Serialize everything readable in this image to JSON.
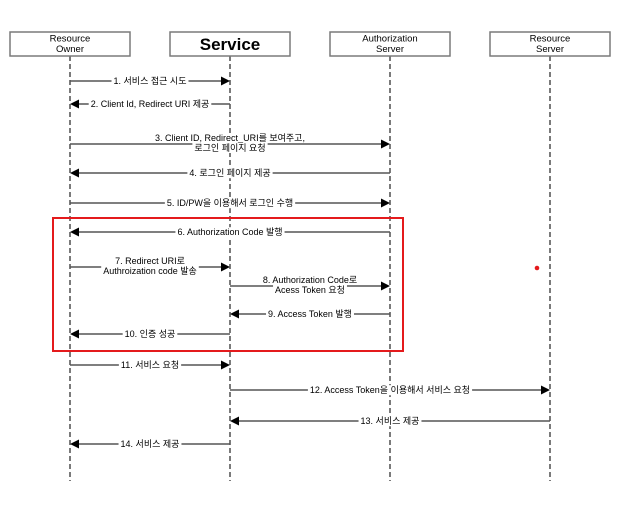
{
  "diagram": {
    "type": "sequence",
    "actors": [
      {
        "id": "resource-owner",
        "label_lines": [
          "Resource",
          "Owner"
        ],
        "emphasis": false
      },
      {
        "id": "service",
        "label_lines": [
          "Service"
        ],
        "emphasis": true
      },
      {
        "id": "authorization-server",
        "label_lines": [
          "Authorization",
          "Server"
        ],
        "emphasis": false
      },
      {
        "id": "resource-server",
        "label_lines": [
          "Resource",
          "Server"
        ],
        "emphasis": false
      }
    ],
    "messages": [
      {
        "step": 1,
        "from": 0,
        "to": 1,
        "label_lines": [
          "1. 서비스 접근 시도"
        ]
      },
      {
        "step": 2,
        "from": 1,
        "to": 0,
        "label_lines": [
          "2. Client Id, Redirect URI 제공"
        ]
      },
      {
        "step": 3,
        "from": 0,
        "to": 2,
        "label_lines": [
          "3. Client ID, Redirect_URI를 보여주고,",
          "로그인 페이지 요청"
        ]
      },
      {
        "step": 4,
        "from": 2,
        "to": 0,
        "label_lines": [
          "4. 로그인 페이지 제공"
        ]
      },
      {
        "step": 5,
        "from": 0,
        "to": 2,
        "label_lines": [
          "5. ID/PW을 이용해서 로그인 수행"
        ]
      },
      {
        "step": 6,
        "from": 2,
        "to": 0,
        "label_lines": [
          "6. Authorization Code 발행"
        ]
      },
      {
        "step": 7,
        "from": 0,
        "to": 1,
        "label_lines": [
          "7. Redirect URI로",
          "Authroization code 발송"
        ]
      },
      {
        "step": 8,
        "from": 1,
        "to": 2,
        "label_lines": [
          "8. Authorization Code로",
          "Acess Token 요청"
        ]
      },
      {
        "step": 9,
        "from": 2,
        "to": 1,
        "label_lines": [
          "9. Access Token 발행"
        ]
      },
      {
        "step": 10,
        "from": 1,
        "to": 0,
        "label_lines": [
          "10. 인증 성공"
        ]
      },
      {
        "step": 11,
        "from": 0,
        "to": 1,
        "label_lines": [
          "11. 서비스 요청"
        ]
      },
      {
        "step": 12,
        "from": 1,
        "to": 3,
        "label_lines": [
          "12. Access Token을 이용해서 서비스 요청"
        ]
      },
      {
        "step": 13,
        "from": 3,
        "to": 1,
        "label_lines": [
          "13. 서비스 제공"
        ]
      },
      {
        "step": 14,
        "from": 1,
        "to": 0,
        "label_lines": [
          "14. 서비스 제공"
        ]
      }
    ],
    "highlight": {
      "from_step": 6,
      "to_step": 10,
      "color": "#e41a1c"
    },
    "marker_dot": {
      "color": "#e41a1c"
    },
    "colors": {
      "box_stroke": "#7a7a7a",
      "lifeline": "#7a7a7a",
      "message_line": "#555555",
      "arrow": "#000000"
    }
  }
}
